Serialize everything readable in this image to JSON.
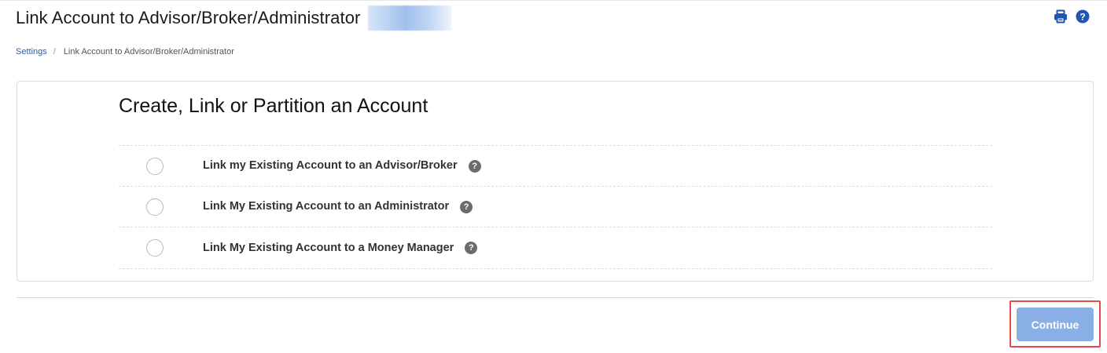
{
  "header": {
    "title": "Link Account to Advisor/Broker/Administrator",
    "tools": [
      {
        "icon": "print-icon",
        "color": "#1f55b5"
      },
      {
        "icon": "help-circle-icon",
        "color": "#1f55b5"
      }
    ]
  },
  "breadcrumb": {
    "items": [
      {
        "label": "Settings",
        "link": true
      },
      {
        "label": "Link Account to Advisor/Broker/Administrator",
        "link": false
      }
    ],
    "separator": "/"
  },
  "card": {
    "title": "Create, Link or Partition an Account",
    "options": [
      {
        "label": "Link my Existing Account to an Advisor/Broker",
        "selected": false,
        "help": "?"
      },
      {
        "label": "Link My Existing Account to an Administrator",
        "selected": false,
        "help": "?"
      },
      {
        "label": "Link My Existing Account to a Money Manager",
        "selected": false,
        "help": "?"
      }
    ]
  },
  "footer": {
    "continue_label": "Continue",
    "continue_enabled": false
  },
  "colors": {
    "link": "#2d5ea8",
    "icon_blue": "#1f55b5",
    "button_disabled": "#8aafe6",
    "highlight": "#e14b4b",
    "help_icon": "#6b6b6b"
  }
}
